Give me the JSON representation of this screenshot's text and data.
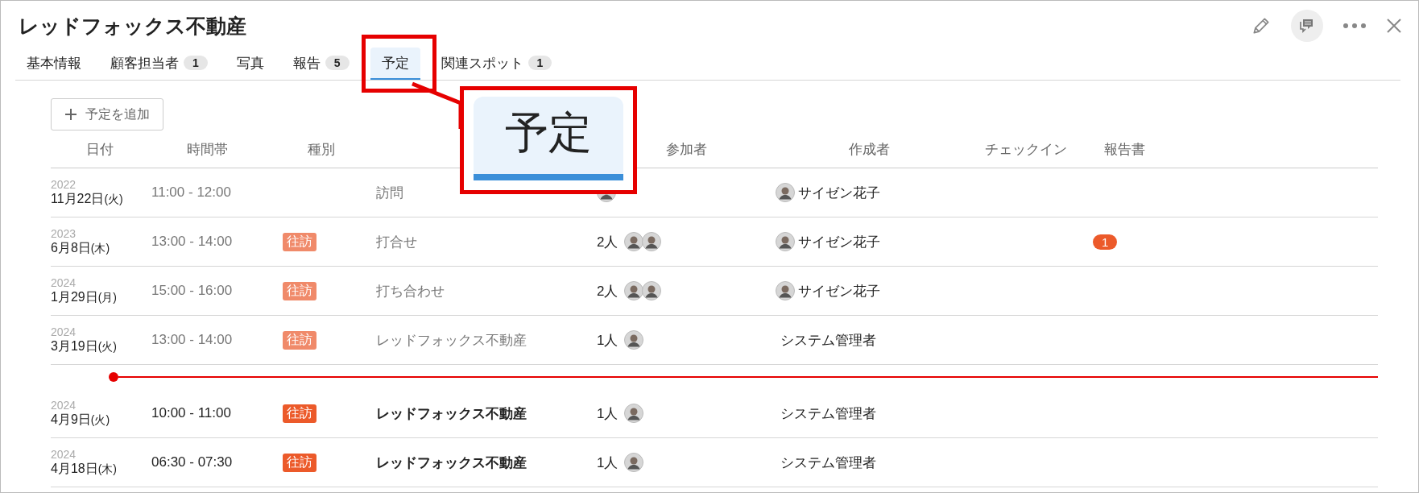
{
  "title": "レッドフォックス不動産",
  "tabs": [
    {
      "label": "基本情報",
      "selected": false
    },
    {
      "label": "顧客担当者",
      "count": "1",
      "selected": false
    },
    {
      "label": "写真",
      "selected": false
    },
    {
      "label": "報告",
      "count": "5",
      "selected": false
    },
    {
      "label": "予定",
      "selected": true
    },
    {
      "label": "関連スポット",
      "count": "1",
      "selected": false
    }
  ],
  "add_button": "予定を追加",
  "columns": [
    "日付",
    "時間帯",
    "種別",
    null,
    "参加者",
    "作成者",
    "チェックイン",
    "報告書"
  ],
  "rows": [
    {
      "kind": "event",
      "past": true,
      "year": "2022",
      "date": "11月22日",
      "weekday": "(火)",
      "time": "11:00 - 12:00",
      "title": "訪問",
      "avatars": [
        {
          "kind": "person"
        }
      ],
      "creator": "サイゼン花子",
      "creator_avatar": true
    },
    {
      "kind": "event",
      "past": true,
      "year": "2023",
      "date": "6月8日",
      "weekday": "(木)",
      "time": "13:00 - 14:00",
      "type": "往訪",
      "title": "打合せ",
      "participant_count": "2人",
      "avatars": [
        {
          "kind": "person"
        },
        {
          "kind": "person"
        }
      ],
      "creator": "サイゼン花子",
      "creator_avatar": true,
      "report": "1"
    },
    {
      "kind": "event",
      "past": true,
      "year": "2024",
      "date": "1月29日",
      "weekday": "(月)",
      "time": "15:00 - 16:00",
      "type": "往訪",
      "title": "打ち合わせ",
      "participant_count": "2人",
      "avatars": [
        {
          "kind": "person"
        },
        {
          "kind": "person"
        }
      ],
      "creator": "サイゼン花子",
      "creator_avatar": true
    },
    {
      "kind": "event",
      "past": true,
      "year": "2024",
      "date": "3月19日",
      "weekday": "(火)",
      "time": "13:00 - 14:00",
      "type": "往訪",
      "title": "レッドフォックス不動産",
      "participant_count": "1人",
      "avatars": [
        {
          "kind": "person"
        }
      ],
      "creator": "システム管理者",
      "creator_avatar": false
    },
    {
      "kind": "now_line"
    },
    {
      "kind": "event",
      "past": false,
      "year": "2024",
      "date": "4月9日",
      "weekday": "(火)",
      "time": "10:00 - 11:00",
      "type": "往訪",
      "title": "レッドフォックス不動産",
      "participant_count": "1人",
      "avatars": [
        {
          "kind": "person"
        }
      ],
      "creator": "システム管理者",
      "creator_avatar": false
    },
    {
      "kind": "event",
      "past": false,
      "year": "2024",
      "date": "4月18日",
      "weekday": "(木)",
      "time": "06:30 - 07:30",
      "type": "往訪",
      "title": "レッドフォックス不動産",
      "participant_count": "1人",
      "avatars": [
        {
          "kind": "person"
        }
      ],
      "creator": "システム管理者",
      "creator_avatar": false
    }
  ],
  "callout": {
    "label": "予定"
  }
}
